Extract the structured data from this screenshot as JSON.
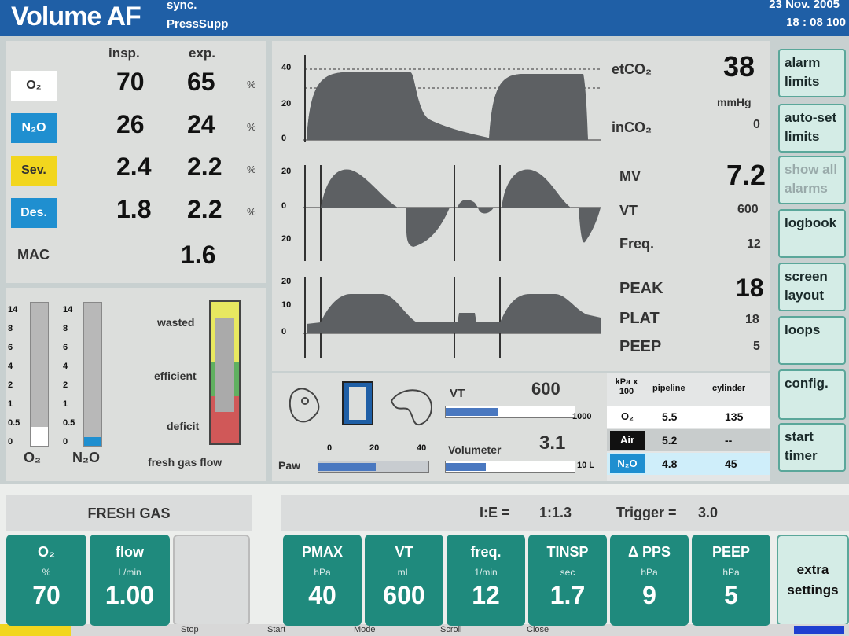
{
  "header": {
    "mode_title": "Volume AF",
    "mode_sub1": "sync.",
    "mode_sub2": "PressSupp",
    "date": "23 Nov. 2005",
    "time": "18 : 08   100"
  },
  "gas": {
    "col_insp": "insp.",
    "col_exp": "exp.",
    "rows": [
      {
        "agent": "O₂",
        "insp": "70",
        "exp": "65",
        "unit": "%",
        "color": "#ffffff",
        "text_color": "#333333"
      },
      {
        "agent": "N₂O",
        "insp": "26",
        "exp": "24",
        "unit": "%",
        "color": "#1f8fd0",
        "text_color": "#ffffff"
      },
      {
        "agent": "Sev.",
        "insp": "2.4",
        "exp": "2.2",
        "unit": "%",
        "color": "#f2d61e",
        "text_color": "#333333"
      },
      {
        "agent": "Des.",
        "insp": "1.8",
        "exp": "2.2",
        "unit": "%",
        "color": "#1f8fd0",
        "text_color": "#ffffff"
      }
    ],
    "mac_label": "MAC",
    "mac_value": "1.6"
  },
  "bars": {
    "scale_ticks": [
      "14",
      "8",
      "6",
      "4",
      "2",
      "1",
      "0.5",
      "0"
    ],
    "o2_label": "O₂",
    "n2o_label": "N₂O",
    "o2_level": 0.13,
    "n2o_level": 0.06,
    "economy": {
      "wasted": "wasted",
      "efficient": "efficient",
      "deficit": "deficit",
      "footer": "fresh gas flow"
    }
  },
  "waves": {
    "co2": {
      "ticks": [
        "40",
        "20",
        "0"
      ],
      "label_et": "etCO₂",
      "value_et": "38",
      "unit": "mmHg",
      "label_in": "inCO₂",
      "value_in": "0"
    },
    "flow": {
      "ticks": [
        "20",
        "0",
        "20"
      ],
      "label_mv": "MV",
      "value_mv": "7.2",
      "label_vt": "VT",
      "value_vt": "600",
      "label_freq": "Freq.",
      "value_freq": "12"
    },
    "paw": {
      "ticks": [
        "20",
        "10",
        "0"
      ],
      "label_peak": "PEAK",
      "value_peak": "18",
      "label_plat": "PLAT",
      "value_plat": "18",
      "label_peep": "PEEP",
      "value_peep": "5"
    }
  },
  "lower": {
    "paw_label": "Paw",
    "paw_ticks": [
      "0",
      "20",
      "40"
    ],
    "paw_level": 0.52,
    "vt_label": "VT",
    "vt_value": "600",
    "vt_max": "1000",
    "vt_level": 0.4,
    "volumeter_label": "Volumeter",
    "volumeter_value": "3.1",
    "volumeter_unit": "10 L",
    "volumeter_level": 0.31,
    "table": {
      "header": [
        "kPa x 100",
        "pipeline",
        "cylinder"
      ],
      "rows": [
        {
          "gas": "O₂",
          "pipeline": "5.5",
          "cylinder": "135",
          "bg": "#ffffff",
          "gas_bg": "#ffffff"
        },
        {
          "gas": "Air",
          "pipeline": "5.2",
          "cylinder": "--",
          "bg": "#c8cccc",
          "gas_bg": "#111111"
        },
        {
          "gas": "N₂O",
          "pipeline": "4.8",
          "cylinder": "45",
          "bg": "#cfeefa",
          "gas_bg": "#1f8fd0"
        }
      ]
    }
  },
  "side_buttons": [
    "alarm limits",
    "auto-set limits",
    "show all alarms",
    "logbook",
    "screen layout",
    "loops",
    "config.",
    "start timer"
  ],
  "fresh_gas": {
    "title": "FRESH GAS",
    "controls": [
      {
        "label": "O₂",
        "unit": "%",
        "value": "70"
      },
      {
        "label": "flow",
        "unit": "L/min",
        "value": "1.00"
      }
    ]
  },
  "vent": {
    "ie_label": "I:E =",
    "ie_value": "1:1.3",
    "trigger_label": "Trigger =",
    "trigger_value": "3.0",
    "controls": [
      {
        "label": "PMAX",
        "unit": "hPa",
        "value": "40"
      },
      {
        "label": "VT",
        "unit": "mL",
        "value": "600"
      },
      {
        "label": "freq.",
        "unit": "1/min",
        "value": "12"
      },
      {
        "label": "TINSP",
        "unit": "sec",
        "value": "1.7"
      },
      {
        "label": "Δ PPS",
        "unit": "hPa",
        "value": "9"
      },
      {
        "label": "PEEP",
        "unit": "hPa",
        "value": "5"
      }
    ],
    "extra_label": "extra settings"
  },
  "status": {
    "items": [
      "Stop",
      "Start",
      "Mode",
      "Scroll",
      "Close"
    ]
  }
}
